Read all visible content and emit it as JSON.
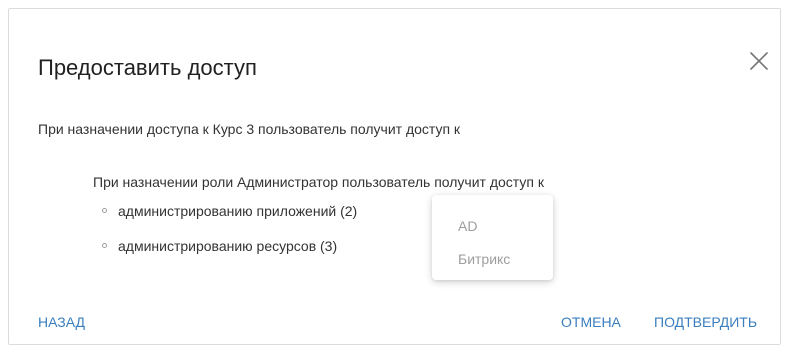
{
  "dialog": {
    "title": "Предоставить доступ",
    "intro": "При назначении доступа к Курс 3 пользователь получит доступ к",
    "role_text": "При назначении роли Администратор пользователь получит доступ к",
    "access_items": [
      "администрированию приложений (2)",
      "администрированию ресурсов (3)"
    ],
    "popup_items": [
      "AD",
      "Битрикс"
    ],
    "footer": {
      "back_label": "НАЗАД",
      "cancel_label": "ОТМЕНА",
      "confirm_label": "ПОДТВЕРДИТЬ"
    },
    "close_icon": "close-icon"
  },
  "colors": {
    "accent": "#3a7ebf",
    "text": "#333333",
    "title": "#212121",
    "muted": "#9e9e9e"
  }
}
